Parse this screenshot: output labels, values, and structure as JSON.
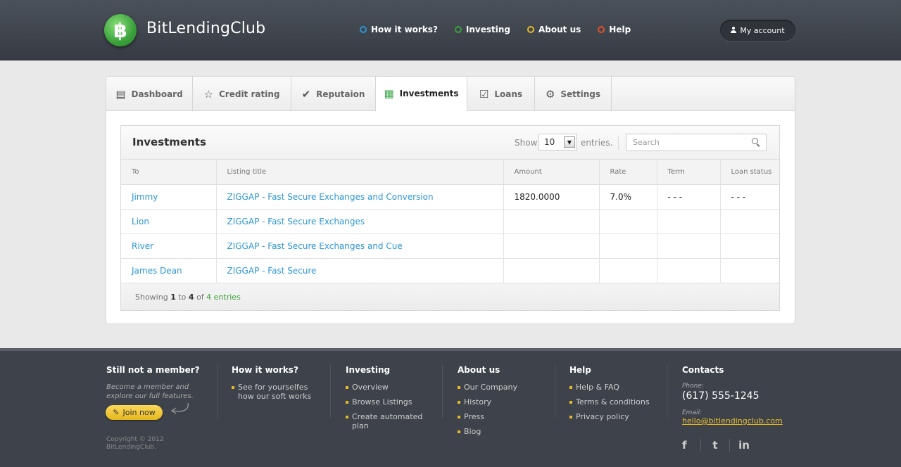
{
  "header": {
    "logo_symbol": "฿",
    "brand": "BitLendingClub",
    "nav": [
      {
        "label": "How it works?",
        "color": "#2b96d6"
      },
      {
        "label": "Investing",
        "color": "#3aa13b"
      },
      {
        "label": "About us",
        "color": "#e8b92a"
      },
      {
        "label": "Help",
        "color": "#e0502a"
      }
    ],
    "account_label": "My account"
  },
  "tabs": [
    {
      "label": "Dashboard",
      "icon": "dashboard-icon",
      "glyph": "▤",
      "active": false
    },
    {
      "label": "Credit rating",
      "icon": "star-icon",
      "glyph": "☆",
      "active": false
    },
    {
      "label": "Reputaion",
      "icon": "check-icon",
      "glyph": "✔",
      "active": false
    },
    {
      "label": "Investments",
      "icon": "document-icon",
      "glyph": "▦",
      "active": true
    },
    {
      "label": "Loans",
      "icon": "checkbox-icon",
      "glyph": "☑",
      "active": false
    },
    {
      "label": "Settings",
      "icon": "gear-icon",
      "glyph": "⚙",
      "active": false
    }
  ],
  "investments": {
    "title": "Investments",
    "show_label": "Show",
    "page_size": "10",
    "entries_label": "entries.",
    "search_placeholder": "Search",
    "columns": [
      "To",
      "Listing title",
      "Amount",
      "Rate",
      "Term",
      "Loan status"
    ],
    "rows": [
      {
        "to": "Jimmy",
        "listing": "ZIGGAP - Fast Secure Exchanges and Conversion",
        "amount": "1820.0000",
        "rate": "7.0%",
        "term": "- - -",
        "status": "- - -"
      },
      {
        "to": "Lion",
        "listing": "ZIGGAP - Fast Secure Exchanges",
        "amount": "",
        "rate": "",
        "term": "",
        "status": ""
      },
      {
        "to": "River",
        "listing": "ZIGGAP - Fast Secure Exchanges and Cue",
        "amount": "",
        "rate": "",
        "term": "",
        "status": ""
      },
      {
        "to": "James Dean",
        "listing": "ZIGGAP - Fast Secure",
        "amount": "",
        "rate": "",
        "term": "",
        "status": ""
      }
    ],
    "footer": {
      "showing": "Showing",
      "from": "1",
      "to_word": "to",
      "to": "4",
      "of": "of",
      "total": "4 entries"
    }
  },
  "footer": {
    "member": {
      "title": "Still not a member?",
      "text": "Become a member and explore our full features.",
      "join_label": "Join now",
      "copyright": "Copyright © 2012\nBitLendingClub."
    },
    "how": {
      "title": "How it works?",
      "items": [
        "See for yourselfes how our soft works"
      ]
    },
    "investing": {
      "title": "Investing",
      "items": [
        "Overview",
        "Browse Listings",
        "Create automated plan"
      ]
    },
    "about": {
      "title": "About us",
      "items": [
        "Our Company",
        "History",
        "Press",
        "Blog"
      ]
    },
    "help": {
      "title": "Help",
      "items": [
        "Help & FAQ",
        "Terms & conditions",
        "Privacy policy"
      ]
    },
    "contacts": {
      "title": "Contacts",
      "phone_label": "Phone:",
      "phone": "(617) 555-1245",
      "email_label": "Email:",
      "email": "hello@bitlendingclub.com"
    },
    "social": [
      {
        "glyph": "f",
        "icon": "facebook-icon"
      },
      {
        "glyph": "t",
        "icon": "twitter-icon"
      },
      {
        "glyph": "in",
        "icon": "linkedin-icon"
      }
    ]
  }
}
